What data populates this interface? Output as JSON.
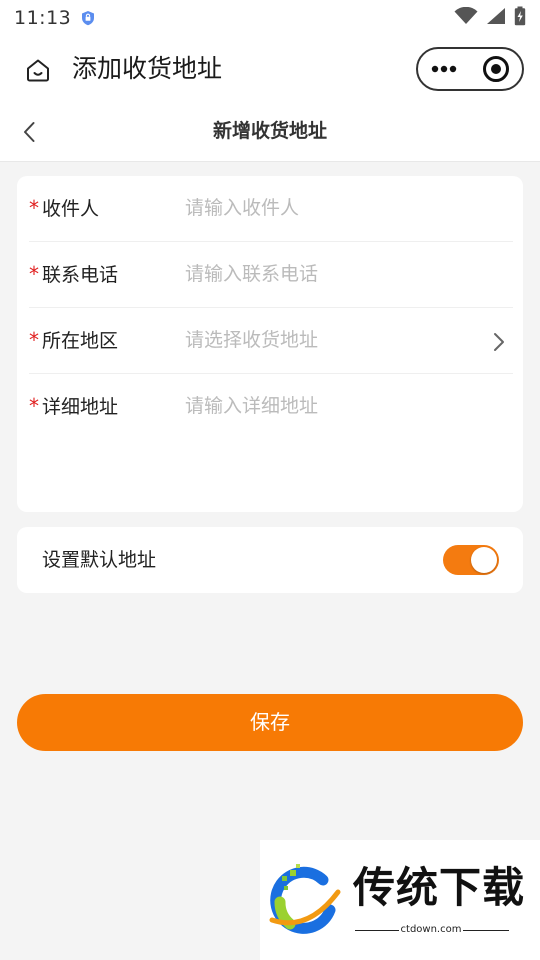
{
  "status_bar": {
    "time": "11:13",
    "icons": [
      "shield-icon",
      "wifi-icon",
      "signal-icon",
      "battery-charging-icon"
    ]
  },
  "mini_program_header": {
    "title": "添加收货地址",
    "home_icon": "home-icon",
    "more_icon": "more-dots-icon",
    "close_icon": "target-close-icon"
  },
  "nav": {
    "title": "新增收货地址",
    "back_icon": "chevron-left-icon"
  },
  "form": {
    "required_mark": "*",
    "fields": [
      {
        "label": "收件人",
        "placeholder": "请输入收件人",
        "value": ""
      },
      {
        "label": "联系电话",
        "placeholder": "请输入联系电话",
        "value": ""
      },
      {
        "label": "所在地区",
        "placeholder": "请选择收货地址",
        "value": "",
        "has_chevron": true
      },
      {
        "label": "详细地址",
        "placeholder": "请输入详细地址",
        "value": ""
      }
    ]
  },
  "default_address": {
    "label": "设置默认地址",
    "enabled": true
  },
  "save_button": {
    "label": "保存"
  },
  "watermark": {
    "text": "传统下载",
    "sub": "ctdown.com"
  },
  "colors": {
    "accent": "#f77a05",
    "required": "#e02020",
    "placeholder": "#bbbbbb",
    "background": "#f4f4f4"
  }
}
